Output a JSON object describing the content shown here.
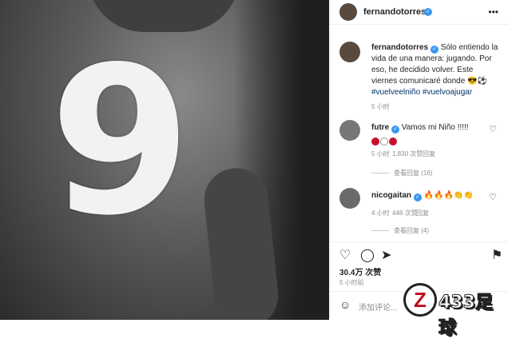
{
  "post": {
    "number": "9"
  },
  "header": {
    "username": "fernandotorres",
    "more": "•••"
  },
  "caption": {
    "username": "fernandotorres",
    "text": "Sólo entiendo la vida de una manera: jugando. Por eso, he decidido volver. Este viernes comunicaré donde 😎⚽",
    "hashtags": "#vuelveelniño #vuelvoajugar",
    "time": "5 小时"
  },
  "comments": [
    {
      "username": "futre",
      "text": "Vamos mi Niño !!!!!",
      "time": "5 小时",
      "likes": "1,830 次赞",
      "reply": "回复",
      "view_replies": "查看回复 (16)"
    },
    {
      "username": "nicogaitan",
      "text": "🔥🔥🔥👏👏",
      "time": "4 小时",
      "likes": "448 次赞",
      "reply": "回复",
      "view_replies": "查看回复 (4)"
    }
  ],
  "engagement": {
    "likes": "30.4万 次赞",
    "time": "5 小时前"
  },
  "composer": {
    "placeholder": "添加评论..."
  },
  "watermark": {
    "brand": "433足球",
    "z": "Z"
  },
  "colors": {
    "verified": "#3897f0",
    "link": "#003569"
  }
}
